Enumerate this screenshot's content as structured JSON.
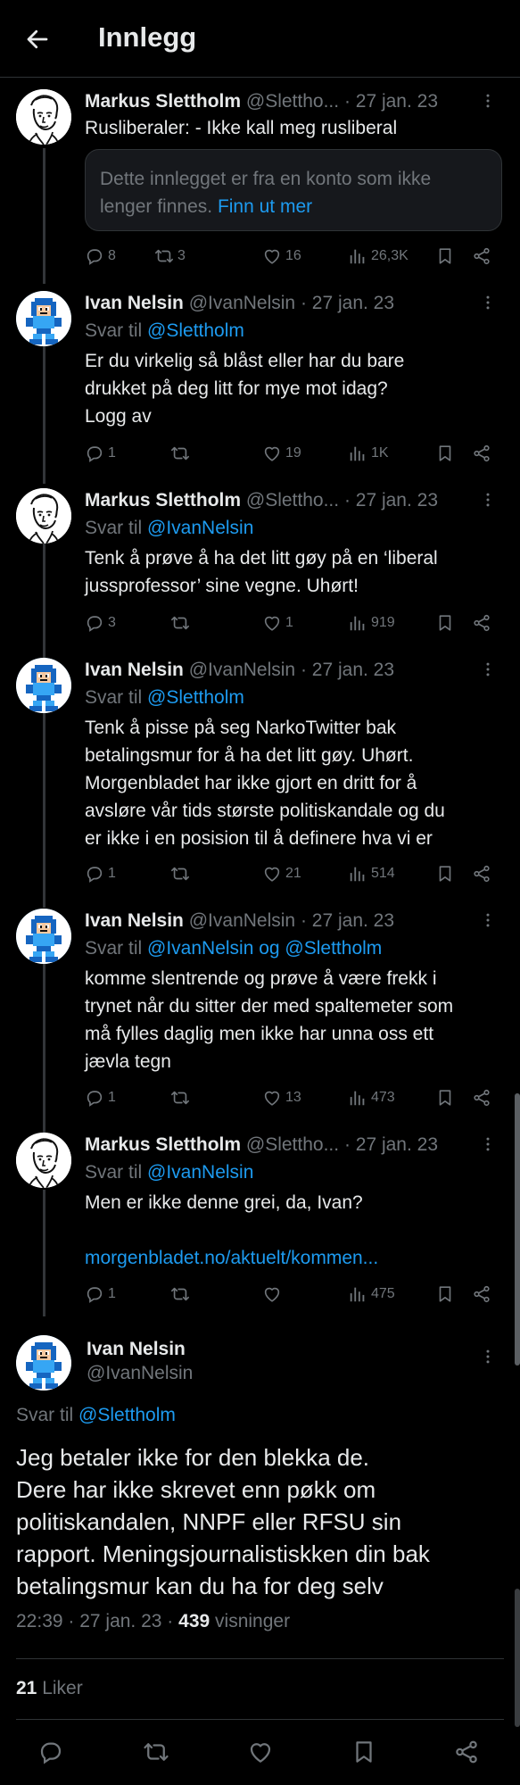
{
  "header": {
    "title": "Innlegg"
  },
  "tweets": [
    {
      "name": "Markus Slettholm",
      "handle": "@Slettho...",
      "date": "· 27 jan. 23",
      "text": "Rusliberaler: - Ikke kall meg rusliberal",
      "notice_text": "Dette innlegget er fra en konto som ikke lenger finnes.",
      "notice_link": "Finn ut mer",
      "replies": "8",
      "reposts": "3",
      "likes": "16",
      "views": "26,3K"
    },
    {
      "name": "Ivan Nelsin",
      "handle": "@IvanNelsin",
      "date": "· 27 jan. 23",
      "reply_prefix": "Svar til",
      "reply_to": "@Slettholm",
      "text": "Er du virkelig så blåst eller har du bare\ndrukket på deg litt for mye mot idag?\nLogg av",
      "replies": "1",
      "reposts": "",
      "likes": "19",
      "views": "1K"
    },
    {
      "name": "Markus Slettholm",
      "handle": "@Slettho...",
      "date": "· 27 jan. 23",
      "reply_prefix": "Svar til",
      "reply_to": "@IvanNelsin",
      "text": "Tenk å prøve å ha det litt gøy på en ‘liberal\njussprofessor’ sine vegne. Uhørt!",
      "replies": "3",
      "reposts": "",
      "likes": "1",
      "views": "919"
    },
    {
      "name": "Ivan Nelsin",
      "handle": "@IvanNelsin",
      "date": "· 27 jan. 23",
      "reply_prefix": "Svar til",
      "reply_to": "@Slettholm",
      "text": "Tenk å pisse på seg NarkoTwitter bak\nbetalingsmur for å ha det litt gøy. Uhørt.\nMorgenbladet har ikke gjort en dritt for å\navsløre vår tids største politiskandale og du\ner ikke i en posision til å definere hva vi er",
      "replies": "1",
      "reposts": "",
      "likes": "21",
      "views": "514"
    },
    {
      "name": "Ivan Nelsin",
      "handle": "@IvanNelsin",
      "date": "· 27 jan. 23",
      "reply_prefix": "Svar til",
      "reply_to": "@IvanNelsin og @Slettholm",
      "text": "komme slentrende og prøve å være frekk i\ntrynet når du sitter der med spaltemeter som\nmå fylles daglig men ikke har unna oss ett\njævla tegn",
      "replies": "1",
      "reposts": "",
      "likes": "13",
      "views": "473"
    },
    {
      "name": "Markus Slettholm",
      "handle": "@Slettho...",
      "date": "· 27 jan. 23",
      "reply_prefix": "Svar til",
      "reply_to": "@IvanNelsin",
      "text": "Men er ikke denne grei, da, Ivan?",
      "link": "morgenbladet.no/aktuelt/kommen...",
      "replies": "1",
      "reposts": "",
      "likes": "",
      "views": "475"
    }
  ],
  "main": {
    "name": "Ivan Nelsin",
    "handle": "@IvanNelsin",
    "reply_prefix": "Svar til",
    "reply_to": "@Slettholm",
    "text": "Jeg betaler ikke for den blekka de.\nDere har ikke skrevet enn pøkk om\npolitiskandalen, NNPF eller RFSU sin\nrapport. Meningsjournalistiskken din bak\nbetalingsmur kan du ha for deg selv",
    "time": "22:39 · 27 jan. 23 ·",
    "views_count": "439",
    "views_label": "visninger",
    "likes_count": "21",
    "likes_label": "Liker"
  },
  "colors": {
    "background": "#000000",
    "text": "#e7e9ea",
    "muted": "#71767b",
    "link": "#1d9bf0",
    "border": "#2f3336"
  }
}
